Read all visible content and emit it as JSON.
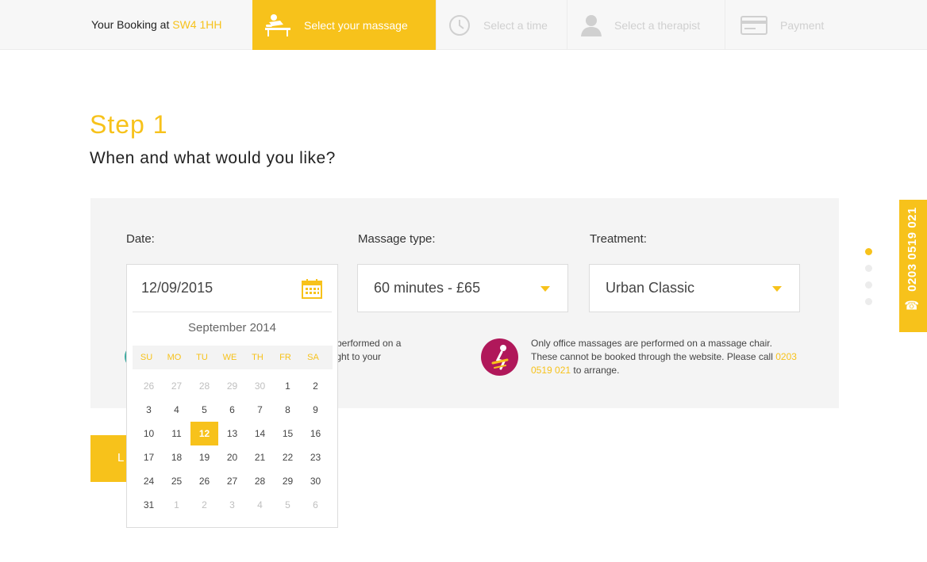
{
  "header": {
    "booking_label": "Your Booking at",
    "postcode": "SW4 1HH",
    "steps": [
      {
        "label": "Select your massage",
        "icon": "massage-table-icon",
        "active": true
      },
      {
        "label": "Select a time",
        "icon": "clock-icon",
        "active": false
      },
      {
        "label": "Select a therapist",
        "icon": "person-icon",
        "active": false
      },
      {
        "label": "Payment",
        "icon": "credit-card-icon",
        "active": false
      }
    ]
  },
  "main": {
    "step_title": "Step 1",
    "step_subtitle": "When and what would you like?",
    "form": {
      "date_label": "Date:",
      "date_value": "12/09/2015",
      "type_label": "Massage type:",
      "type_value": "60 minutes - £65",
      "treatment_label": "Treatment:",
      "treatment_value": "Urban Classic"
    },
    "info_left_partial_line1": "re performed on a",
    "info_left_partial_line2": "ought to your",
    "info_right_text": "Only office massages are performed on a massage chair. These cannot be booked through the website. Please call",
    "info_right_phone": "0203 0519 021",
    "info_right_suffix": "to arrange.",
    "button_partial_label": "L"
  },
  "calendar": {
    "title": "September 2014",
    "days_of_week": [
      "SU",
      "MO",
      "TU",
      "WE",
      "TH",
      "FR",
      "SA"
    ],
    "weeks": [
      [
        "26",
        "27",
        "28",
        "29",
        "30",
        "1",
        "2"
      ],
      [
        "3",
        "4",
        "5",
        "6",
        "7",
        "8",
        "9"
      ],
      [
        "10",
        "11",
        "12",
        "13",
        "14",
        "15",
        "16"
      ],
      [
        "17",
        "18",
        "19",
        "20",
        "21",
        "22",
        "23"
      ],
      [
        "24",
        "25",
        "26",
        "27",
        "28",
        "29",
        "30"
      ],
      [
        "31",
        "1",
        "2",
        "3",
        "4",
        "5",
        "6"
      ]
    ],
    "selected_day": "12"
  },
  "side": {
    "phone": "0203 0519 021",
    "pagination_count": 4,
    "pagination_active": 0
  },
  "colors": {
    "accent": "#f7c21b",
    "panel_bg": "#f4f4f4",
    "badge_teal": "#3aa99f",
    "badge_magenta": "#b0185a"
  }
}
